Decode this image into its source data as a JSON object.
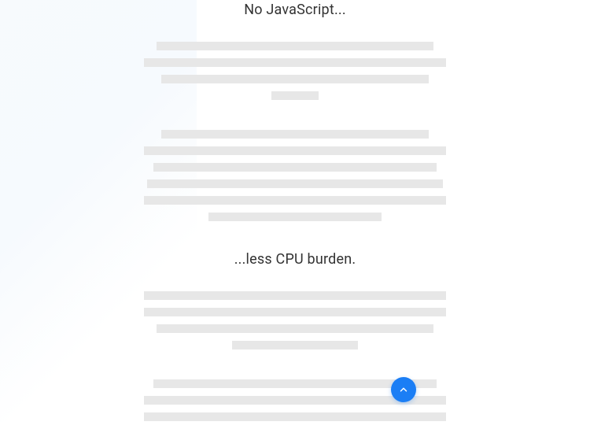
{
  "headings": {
    "heading1": "No JavaScript...",
    "heading2": "...less CPU burden."
  },
  "scrollTop": {
    "aria": "Scroll to top"
  }
}
